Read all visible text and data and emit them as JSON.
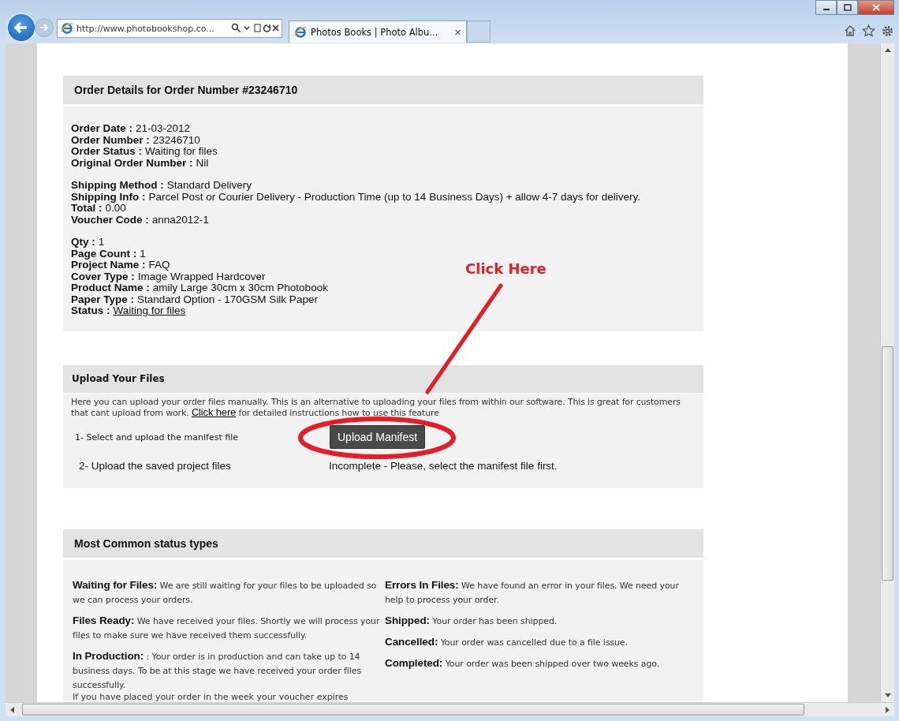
{
  "browser": {
    "address": "http://www.photobookshop.co...",
    "tab": "Photos Books | Photo Albu...",
    "tab_close": "×"
  },
  "order_details": {
    "title": "Order Details for Order Number #23246710",
    "groups": [
      [
        {
          "label": "Order Date :",
          "value": "21-03-2012",
          "kind": "text"
        },
        {
          "label": "Order Number :",
          "value": "23246710",
          "kind": "text"
        },
        {
          "label": "Order Status :",
          "value": "Waiting for files",
          "kind": "text"
        },
        {
          "label": "Original Order Number :",
          "value": "Nil",
          "kind": "text"
        }
      ],
      [
        {
          "label": "Shipping Method :",
          "value": "Standard Delivery",
          "kind": "text"
        },
        {
          "label": "Shipping Info :",
          "value": "Parcel Post or Courier Delivery - Production Time (up to 14 Business Days) + allow 4-7 days for delivery.",
          "kind": "text"
        },
        {
          "label": "Total :",
          "value": "0.00",
          "kind": "text"
        },
        {
          "label": "Voucher Code :",
          "value": "anna2012-1",
          "kind": "text"
        }
      ],
      [
        {
          "label": "Qty :",
          "value": "1",
          "kind": "text"
        },
        {
          "label": "Page Count :",
          "value": "1",
          "kind": "text"
        },
        {
          "label": "Project Name :",
          "value": "FAQ",
          "kind": "text"
        },
        {
          "label": "Cover Type :",
          "value": "Image Wrapped Hardcover",
          "kind": "text"
        },
        {
          "label": "Product Name :",
          "value": "amily Large 30cm x 30cm Photobook",
          "kind": "text"
        },
        {
          "label": "Paper Type :",
          "value": "Standard Option - 170GSM Silk Paper",
          "kind": "text"
        },
        {
          "label": "Status :",
          "value": "Waiting for files",
          "kind": "link"
        }
      ]
    ]
  },
  "upload": {
    "title": "Upload Your Files",
    "intro_before": "Here you can upload your order files manually. This is an alternative to uploading your files from within our software. This is great for customers that cant upload from work.",
    "intro_link": "Click here",
    "intro_after": "for detailed instructions how to use this feature",
    "steps": [
      {
        "label": "1- Select and upload the manifest file",
        "kind": "button",
        "action": "Upload Manifest"
      },
      {
        "label": "2- Upload the saved project files",
        "kind": "text",
        "action": "Incomplete - Please, select the manifest file first."
      }
    ]
  },
  "annotation": {
    "label": "Click Here"
  },
  "status_types": {
    "title": "Most Common status types",
    "columns": [
      [
        {
          "term": "Waiting for Files:",
          "description": "We are still waiting for your files to be uploaded so we can process your orders."
        },
        {
          "term": "Files Ready:",
          "description": "We have received your files. Shortly we will process your files to make sure we have received them successfully."
        },
        {
          "term": "In Production:",
          "description": ": Your order is in production and can take up to 14 business days. To be at this stage we have received your order files successfully."
        }
      ],
      [
        {
          "term": "Errors In Files:",
          "description": "We have found an error in your files. We need your help to process your order."
        },
        {
          "term": "Shipped:",
          "description": "Your order has been shipped."
        },
        {
          "term": "Cancelled:",
          "description": "Your order was cancelled due to a file issue."
        },
        {
          "term": "Completed:",
          "description": "Your order was been shipped over two weeks ago."
        }
      ]
    ],
    "note": "If you have placed your order in the week your voucher expires"
  }
}
